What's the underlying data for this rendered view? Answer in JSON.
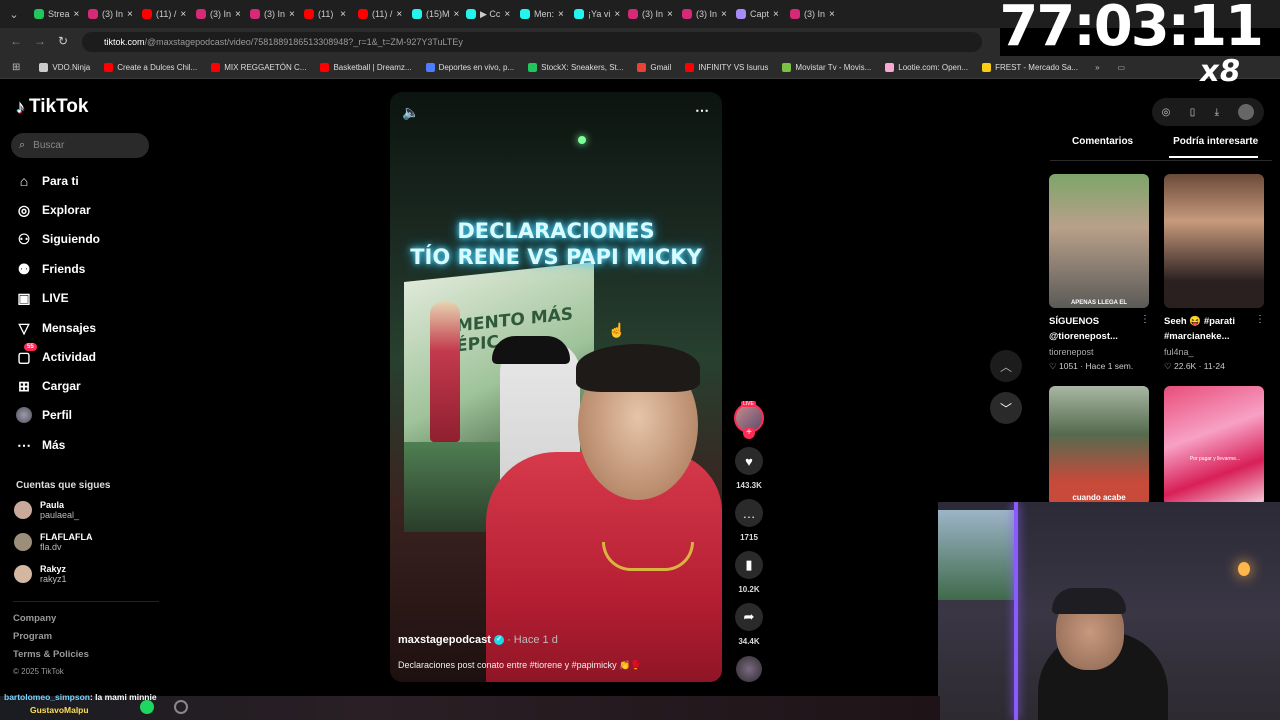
{
  "tabs": [
    {
      "label": "Strea",
      "color": "#22c55e"
    },
    {
      "label": "(3) In",
      "color": "#d62976"
    },
    {
      "label": "(11) /",
      "color": "#ff0000"
    },
    {
      "label": "(3) In",
      "color": "#d62976"
    },
    {
      "label": "(3) In",
      "color": "#d62976"
    },
    {
      "label": "(11)",
      "color": "#ff0000"
    },
    {
      "label": "(11) /",
      "color": "#ff0000"
    },
    {
      "label": "(15)M",
      "color": "#25f4ee"
    },
    {
      "label": "▶ Cc",
      "color": "#25f4ee"
    },
    {
      "label": "Men:",
      "color": "#25f4ee"
    },
    {
      "label": "¡Ya vi",
      "color": "#25f4ee"
    },
    {
      "label": "(3) In",
      "color": "#d62976"
    },
    {
      "label": "(3) In",
      "color": "#d62976"
    },
    {
      "label": "Capt",
      "color": "#a78bfa"
    },
    {
      "label": "(3) In",
      "color": "#d62976"
    }
  ],
  "address": {
    "host": "tiktok.com",
    "path": "/@maxstagepodcast/video/7581889186513308948?_r=1&_t=ZM-927Y3TuLTEy"
  },
  "bookmarks": [
    {
      "label": "VDO.Ninja",
      "color": "#cccccc"
    },
    {
      "label": "Create a Dulces Chil...",
      "color": "#ff0000"
    },
    {
      "label": "MIX REGGAETÓN C...",
      "color": "#ff0000"
    },
    {
      "label": "Basketball | Dreamz...",
      "color": "#ff0000"
    },
    {
      "label": "Deportes en vivo, p...",
      "color": "#4f7cff"
    },
    {
      "label": "StockX: Sneakers, St...",
      "color": "#22c55e"
    },
    {
      "label": "Gmail",
      "color": "#ea4335"
    },
    {
      "label": "INFINITY VS Isurus",
      "color": "#ff0000"
    },
    {
      "label": "Movistar Tv - Movis...",
      "color": "#7bc043"
    },
    {
      "label": "Lootie.com: Open...",
      "color": "#f9a8d4"
    },
    {
      "label": "FREST - Mercado Sa...",
      "color": "#facc15"
    }
  ],
  "overlay": {
    "timer": "77:03:11",
    "multiplier": "x8"
  },
  "sidebar": {
    "logo": "TikTok",
    "search_placeholder": "Buscar",
    "nav": [
      {
        "label": "Para ti",
        "icon": "home-icon"
      },
      {
        "label": "Explorar",
        "icon": "compass-icon"
      },
      {
        "label": "Siguiendo",
        "icon": "user-follow-icon"
      },
      {
        "label": "Friends",
        "icon": "friends-icon"
      },
      {
        "label": "LIVE",
        "icon": "live-icon"
      },
      {
        "label": "Mensajes",
        "icon": "send-icon"
      },
      {
        "label": "Actividad",
        "icon": "bell-icon",
        "badge": "55"
      },
      {
        "label": "Cargar",
        "icon": "plus-box-icon"
      },
      {
        "label": "Perfil",
        "icon": "avatar-icon"
      },
      {
        "label": "Más",
        "icon": "more-icon"
      }
    ],
    "following_header": "Cuentas que sigues",
    "following": [
      {
        "name": "Paula",
        "handle": "paulaeal_"
      },
      {
        "name": "FLAFLAFLA",
        "handle": "fla.dv"
      },
      {
        "name": "Rakyz",
        "handle": "rakyz1"
      }
    ],
    "footer": [
      "Company",
      "Program",
      "Terms & Policies",
      "© 2025 TikTok"
    ]
  },
  "video": {
    "title_line1": "DECLARACIONES",
    "title_line2": "TÍO RENE VS PAPI MICKY",
    "author": "maxstagepodcast",
    "ago": "· Hace 1 d",
    "description": "Declaraciones post conato entre #tiorene y #papimicky 👏🥊",
    "stage_text": "MENTO MÁS ÉPIC"
  },
  "actions": {
    "likes": "143.3K",
    "comments": "1715",
    "saves": "10.2K",
    "shares": "34.4K"
  },
  "right_panel": {
    "tabs": [
      "Comentarios",
      "Podría interesarte"
    ],
    "cards": [
      {
        "title": "SÍGUENOS @tiorenepost...",
        "user": "tiorenepost",
        "likes": "1051",
        "date": "Hace 1 sem.",
        "overlay": "APENAS LLEGA EL"
      },
      {
        "title": "Seeh 😝 #parati #marcianeke...",
        "user": "ful4na_",
        "likes": "22.6K",
        "date": "11-24"
      },
      {
        "overlay": "cuando acabe"
      },
      {
        "overlay": "Por pagar y llevarme..."
      }
    ]
  },
  "chat": {
    "user": "bartolomeo_simpson",
    "message": ": la mami minnie",
    "user2": "GustavoMalpu"
  }
}
